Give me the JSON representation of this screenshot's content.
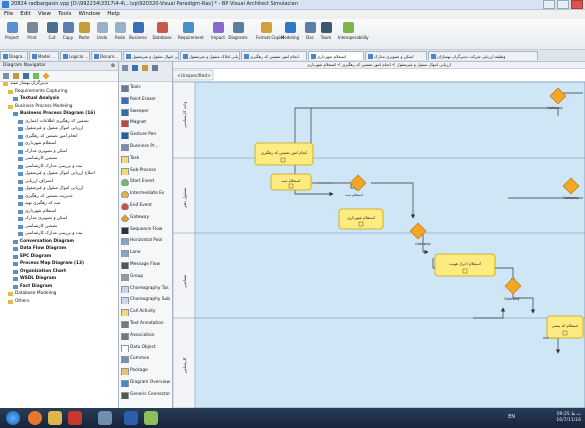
{
  "window": {
    "title": "20824 radbargasin.vpp [D:\\992234\\3317\\4-4\\...\\vp\\920320-Visual Paradigm-Ras] * - BP Visual Architect Simulacian"
  },
  "menubar": [
    "File",
    "Edit",
    "View",
    "Tools",
    "Window",
    "Help"
  ],
  "toolbar": [
    {
      "label": "Project",
      "icon": "project-icon",
      "color": "#5b8fd1"
    },
    {
      "label": "Print",
      "icon": "print-icon",
      "color": "#7a8796"
    },
    {
      "label": "Cut",
      "icon": "cut-icon",
      "color": "#4d6d93"
    },
    {
      "label": "Copy",
      "icon": "copy-icon",
      "color": "#5d7fb0"
    },
    {
      "label": "Paste",
      "icon": "paste-icon",
      "color": "#c79a3a"
    },
    {
      "label": "Undo",
      "icon": "undo-icon",
      "color": "#9ab0c8"
    },
    {
      "label": "Redo",
      "icon": "redo-icon",
      "color": "#9ab0c8"
    },
    {
      "label": "Business",
      "icon": "business-icon",
      "color": "#3a6fb7"
    },
    {
      "label": "Database",
      "icon": "database-icon",
      "color": "#c75a4a"
    },
    {
      "label": "Requirement",
      "icon": "requirement-icon",
      "color": "#4a90c8"
    },
    {
      "label": "Impact",
      "icon": "impact-icon",
      "color": "#8a6ad1"
    },
    {
      "label": "Diagrams",
      "icon": "diagrams-icon",
      "color": "#5a7f9e"
    },
    {
      "label": "Format Copier",
      "icon": "format-copier-icon",
      "color": "#d1a03a"
    },
    {
      "label": "Modeling",
      "icon": "modeling-icon",
      "color": "#2f7ac6"
    },
    {
      "label": "Doc",
      "icon": "doc-icon",
      "color": "#5c7ea5"
    },
    {
      "label": "Team",
      "icon": "team-icon",
      "color": "#3c5674"
    },
    {
      "label": "Interoperability",
      "icon": "interoperability-icon",
      "color": "#7ab648"
    }
  ],
  "tabs": [
    {
      "label": "Diagra...",
      "active": false
    },
    {
      "label": "Model ...",
      "active": false
    },
    {
      "label": "Logical ...",
      "active": false
    },
    {
      "label": "Docum...",
      "active": false
    },
    {
      "label": "ارزیابی اموال منقول و غیرمنقول",
      "active": false
    },
    {
      "label": "ارزیابی املاک منقول و غیرمنقول",
      "active": false
    },
    {
      "label": "انجام امور تضمین کد رهگیری",
      "active": false
    },
    {
      "label": "استعلام شهرداری",
      "active": true
    },
    {
      "label": "اسکن و تصویری مدارک",
      "active": false
    },
    {
      "label": "وظیفه ارزیابی شرکت تدبیرگران بهسازان",
      "active": false
    }
  ],
  "left_panel": {
    "header": "Diagram Navigator",
    "tree": [
      {
        "label": "تدبیرگران بهساز مفید",
        "level": 0,
        "bold": false,
        "icon": "folder-icon"
      },
      {
        "label": "Requirements Capturing",
        "level": 1,
        "bold": false,
        "icon": "folder-icon"
      },
      {
        "label": "Textual Analysis",
        "level": 2,
        "bold": true,
        "icon": "diagram-icon"
      },
      {
        "label": "Business Process Modeling",
        "level": 1,
        "bold": false,
        "icon": "folder-icon"
      },
      {
        "label": "Business Process Diagram (16)",
        "level": 2,
        "bold": true,
        "icon": "diagram-icon"
      },
      {
        "label": "تضمین کد رهگیری اطلاعات اعتباری",
        "level": 3,
        "bold": false,
        "icon": "diagram-icon"
      },
      {
        "label": "ارزیابی اموال منقول و غیرمنقول",
        "level": 3,
        "bold": false,
        "icon": "diagram-icon"
      },
      {
        "label": "انجام امور تضمین کد رهگیری",
        "level": 3,
        "bold": false,
        "icon": "diagram-icon"
      },
      {
        "label": "استعلام شهرداری",
        "level": 3,
        "bold": false,
        "icon": "diagram-icon"
      },
      {
        "label": "اسکن و تصویری مدارک",
        "level": 3,
        "bold": false,
        "icon": "diagram-icon"
      },
      {
        "label": "تضمین کارشناسی",
        "level": 3,
        "bold": false,
        "icon": "diagram-icon"
      },
      {
        "label": "ثبت و بررسی مدارک کارشناسی",
        "level": 3,
        "bold": false,
        "icon": "diagram-icon"
      },
      {
        "label": "اصلاح ارزیابی اموال منقول و غیرمنقول",
        "level": 3,
        "bold": false,
        "icon": "diagram-icon"
      },
      {
        "label": "انصراف ارزیابی",
        "level": 3,
        "bold": false,
        "icon": "diagram-icon"
      },
      {
        "label": "ارزیابی اموال منقول و غیرمنقول",
        "level": 3,
        "bold": false,
        "icon": "diagram-icon"
      },
      {
        "label": "مدیریت تضمین کد رهگیری",
        "level": 3,
        "bold": false,
        "icon": "diagram-icon"
      },
      {
        "label": "ثبت کد رهگیری تهیه",
        "level": 3,
        "bold": false,
        "icon": "diagram-icon"
      },
      {
        "label": "استعلام شهرداری",
        "level": 3,
        "bold": false,
        "icon": "diagram-icon"
      },
      {
        "label": "اسکن و تصویری مدارک",
        "level": 3,
        "bold": false,
        "icon": "diagram-icon"
      },
      {
        "label": "تضمین کارشناسی",
        "level": 3,
        "bold": false,
        "icon": "diagram-icon"
      },
      {
        "label": "ثبت و بررسی مدارک کارشناسی",
        "level": 3,
        "bold": false,
        "icon": "diagram-icon"
      },
      {
        "label": "Conversation Diagram",
        "level": 2,
        "bold": true,
        "icon": "diagram-icon"
      },
      {
        "label": "Data Flow Diagram",
        "level": 2,
        "bold": true,
        "icon": "diagram-icon"
      },
      {
        "label": "EPC Diagram",
        "level": 2,
        "bold": true,
        "icon": "diagram-icon"
      },
      {
        "label": "Process Map Diagram (13)",
        "level": 2,
        "bold": true,
        "icon": "diagram-icon"
      },
      {
        "label": "Organization Chart",
        "level": 2,
        "bold": true,
        "icon": "diagram-icon"
      },
      {
        "label": "WSDL Diagram",
        "level": 2,
        "bold": true,
        "icon": "diagram-icon"
      },
      {
        "label": "Fact Diagram",
        "level": 2,
        "bold": true,
        "icon": "diagram-icon"
      },
      {
        "label": "Database Modeling",
        "level": 1,
        "bold": false,
        "icon": "folder-icon"
      },
      {
        "label": "Others",
        "level": 1,
        "bold": false,
        "icon": "folder-icon"
      }
    ]
  },
  "palette": {
    "items": [
      {
        "label": "Tools",
        "icon": "tools-icon",
        "color": "#6b7c90"
      },
      {
        "label": "Point Eraser",
        "icon": "eraser-icon",
        "color": "#3e6fb3"
      },
      {
        "label": "Sweeper",
        "icon": "sweeper-icon",
        "color": "#3b6aa5"
      },
      {
        "label": "Magnet",
        "icon": "magnet-icon",
        "color": "#c44a3c"
      },
      {
        "label": "Gesture Pen",
        "icon": "pen-icon",
        "color": "#2c5f9e"
      },
      {
        "label": "Business Pr...",
        "icon": "business-process-icon",
        "color": "#7b8ea6"
      },
      {
        "label": "Task",
        "icon": "task-icon",
        "color": "#f2d97a"
      },
      {
        "label": "Sub-Process",
        "icon": "subprocess-icon",
        "color": "#f2d97a"
      },
      {
        "label": "Start Event",
        "icon": "start-event-icon",
        "color": "#6bbf59"
      },
      {
        "label": "Intermediate Ev",
        "icon": "intermediate-event-icon",
        "color": "#e8b341"
      },
      {
        "label": "End Event",
        "icon": "end-event-icon",
        "color": "#d24c3c"
      },
      {
        "label": "Gateway",
        "icon": "gateway-icon",
        "color": "#e89c2b"
      },
      {
        "label": "Sequence Flow",
        "icon": "sequence-flow-icon",
        "color": "#333333"
      },
      {
        "label": "Horizontal Pool",
        "icon": "horizontal-pool-icon",
        "color": "#8aa4c3"
      },
      {
        "label": "Lane",
        "icon": "lane-icon",
        "color": "#8aa4c3"
      },
      {
        "label": "Message Flow",
        "icon": "message-flow-icon",
        "color": "#555555"
      },
      {
        "label": "Group",
        "icon": "group-icon",
        "color": "#999999"
      },
      {
        "label": "Choreography Tas",
        "icon": "choreography-task-icon",
        "color": "#c9d6e6"
      },
      {
        "label": "Choreography Sub",
        "icon": "choreography-sub-icon",
        "color": "#c9d6e6"
      },
      {
        "label": "Call Activity",
        "icon": "call-activity-icon",
        "color": "#f2d97a"
      },
      {
        "label": "Text Annotation",
        "icon": "text-annotation-icon",
        "color": "#777777"
      },
      {
        "label": "Association",
        "icon": "association-icon",
        "color": "#777777"
      },
      {
        "label": "Data Object",
        "icon": "data-object-icon",
        "color": "#ffffff"
      },
      {
        "label": "Common",
        "icon": "common-icon",
        "color": "#7b8ea6"
      },
      {
        "label": "Package",
        "icon": "package-icon",
        "color": "#e9c46a"
      },
      {
        "label": "Diagram Overview",
        "icon": "diagram-overview-icon",
        "color": "#4b86c9"
      },
      {
        "label": "Generic Connector",
        "icon": "generic-connector-icon",
        "color": "#555555"
      }
    ]
  },
  "canvas": {
    "breadcrumb": "ارزیابی اموال منقول و غیرمنقول > انجام امور تضمین کد رهگیری > استعلام شهرداری",
    "unspecified_label": "<Unspecified>",
    "lanes": [
      "واحد کارشناسی",
      "مسئول دفتر",
      "متقاضی",
      "کارشناس"
    ],
    "tasks": [
      {
        "label": "انجام امور تضمین کد رهگیری"
      },
      {
        "label": "استعلام ثبت"
      },
      {
        "label": "استعلام شهرداری"
      },
      {
        "label": "استعلام احراز هویت"
      },
      {
        "label": "استعلام کد پستی"
      }
    ],
    "gateways": [
      "Gateway",
      "استعلام ثبت",
      "Gateway",
      "Gateway",
      "Gateway"
    ],
    "colors": {
      "pool_fill": "#cfe6f6",
      "task_fill": "#ffeb80",
      "task_border": "#c9a300",
      "gateway_fill": "#f5a623",
      "lane_label_bg": "#f2f4f7"
    }
  },
  "taskbar": {
    "language": "EN",
    "time": "09:25 ب.ظ",
    "date": "16/7/11/16"
  }
}
